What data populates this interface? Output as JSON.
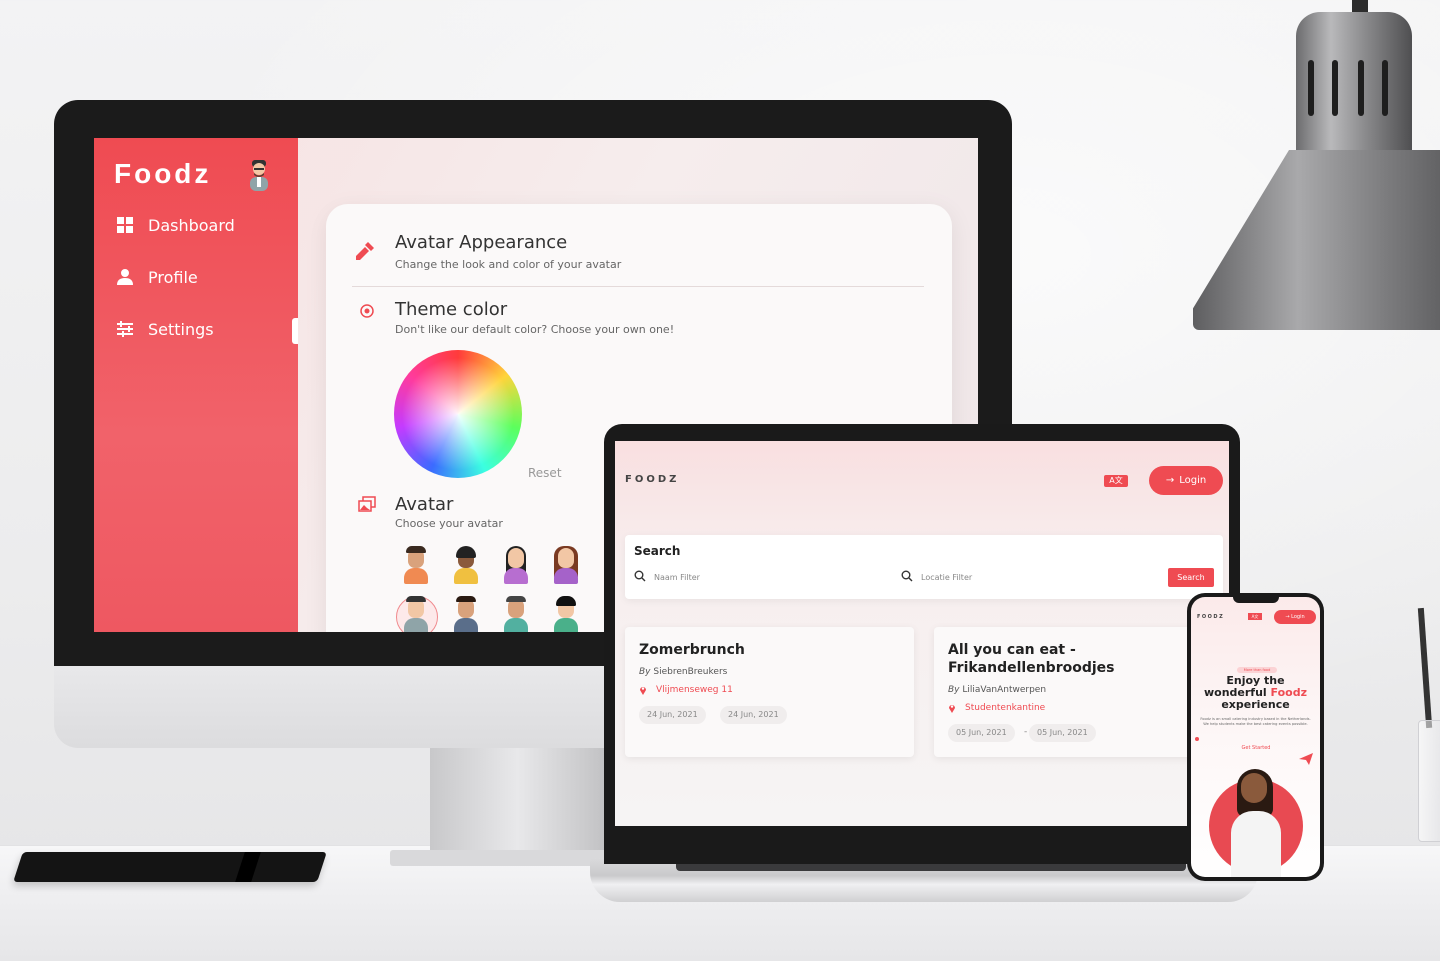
{
  "imac": {
    "app": {
      "brand": "Foodz",
      "nav": [
        {
          "label": "Dashboard",
          "icon": "dashboard-icon"
        },
        {
          "label": "Profile",
          "icon": "user-icon"
        },
        {
          "label": "Settings",
          "icon": "sliders-icon"
        }
      ]
    },
    "settings": {
      "appearance_title": "Avatar Appearance",
      "appearance_sub": "Change the look and color of your avatar",
      "theme_title": "Theme color",
      "theme_sub": "Don't like our default color? Choose your own one!",
      "reset_label": "Reset",
      "avatar_title": "Avatar",
      "avatar_sub": "Choose your avatar"
    }
  },
  "laptop": {
    "brand": "FOODZ",
    "lang_label": "A文",
    "login_label": "Login",
    "search": {
      "title": "Search",
      "name_placeholder": "Naam Filter",
      "location_placeholder": "Locatie Filter",
      "button": "Search"
    },
    "events": [
      {
        "title": "Zomerbrunch",
        "by_prefix": "By",
        "author": "SiebrenBreukers",
        "location": "Vlijmenseweg 11",
        "start": "24 Jun, 2021",
        "end": "24 Jun, 2021"
      },
      {
        "title": "All you can eat - Frikandellenbroodjes",
        "by_prefix": "By",
        "author": "LiliaVanAntwerpen",
        "location": "Studentenkantine",
        "start": "05 Jun, 2021",
        "end": "05 Jun, 2021"
      }
    ]
  },
  "phone": {
    "brand": "FOODZ",
    "lang_label": "A文",
    "login_label": "Login",
    "tag": "More than food",
    "headline_1": "Enjoy the",
    "headline_2": "wonderful",
    "headline_accent": "Foodz",
    "headline_3": "experience",
    "description": "Foodz is an small catering industry based in the Netherlands. We help students make the best catering events possible.",
    "cta": "Get Started"
  },
  "colors": {
    "accent": "#ef4b52",
    "background": "#f3f3f4"
  }
}
